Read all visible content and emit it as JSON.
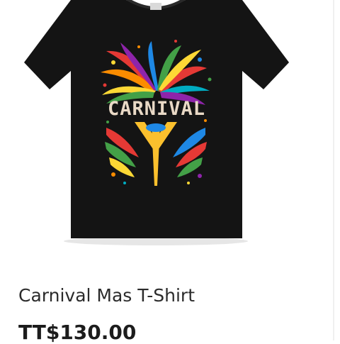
{
  "product": {
    "name": "Carnival Mas T-Shirt",
    "price": "TT$130.00",
    "image": {
      "design_text": "CARNIVAL",
      "shirt_color": "#141414",
      "accent_colors": [
        "#e53935",
        "#1e88e5",
        "#43a047",
        "#fdd835",
        "#fb8c00",
        "#8e24aa",
        "#00acc1"
      ]
    }
  }
}
